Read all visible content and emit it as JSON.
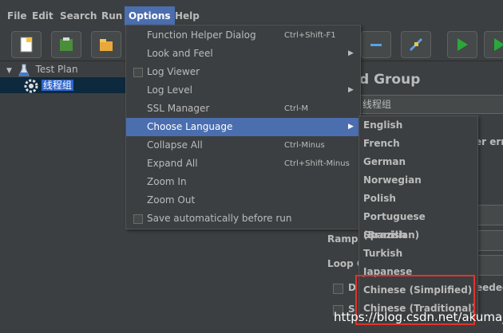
{
  "menubar": {
    "file": "File",
    "edit": "Edit",
    "search": "Search",
    "run": "Run",
    "options": "Options",
    "help": "Help"
  },
  "tree": {
    "root": "Test Plan",
    "child": "线程组"
  },
  "options_menu": {
    "items": [
      {
        "label": "Function Helper Dialog",
        "accel": "Ctrl+Shift-F1"
      },
      {
        "label": "Look and Feel",
        "accel": ""
      },
      {
        "label": "Log Viewer",
        "accel": ""
      },
      {
        "label": "Log Level",
        "accel": ""
      },
      {
        "label": "SSL Manager",
        "accel": "Ctrl-M"
      },
      {
        "label": "Choose Language",
        "accel": ""
      },
      {
        "label": "Collapse All",
        "accel": "Ctrl-Minus"
      },
      {
        "label": "Expand All",
        "accel": "Ctrl+Shift-Minus"
      },
      {
        "label": "Zoom In",
        "accel": ""
      },
      {
        "label": "Zoom Out",
        "accel": ""
      },
      {
        "label": "Save automatically before run",
        "accel": ""
      }
    ]
  },
  "language_menu": {
    "items": [
      "English",
      "French",
      "German",
      "Norwegian",
      "Polish",
      "Portuguese (Brazilian)",
      "Spanish",
      "Turkish",
      "Japanese",
      "Chinese (Simplified)",
      "Chinese (Traditional)"
    ]
  },
  "right_panel": {
    "heading": "d Group",
    "name_value": "线程组",
    "error_text": "er erro",
    "ramp_label": "Ramp-",
    "loop_label": "Loop C",
    "row_d": "D",
    "row_s": "S",
    "needed_text": "eeded"
  },
  "watermark": "https://blog.csdn.net/akuma_",
  "colors": {
    "background": "#3c3f41",
    "highlight": "#4b6eaf",
    "tree_selection": "#2f65ca",
    "annotation_box": "#e0332b"
  }
}
